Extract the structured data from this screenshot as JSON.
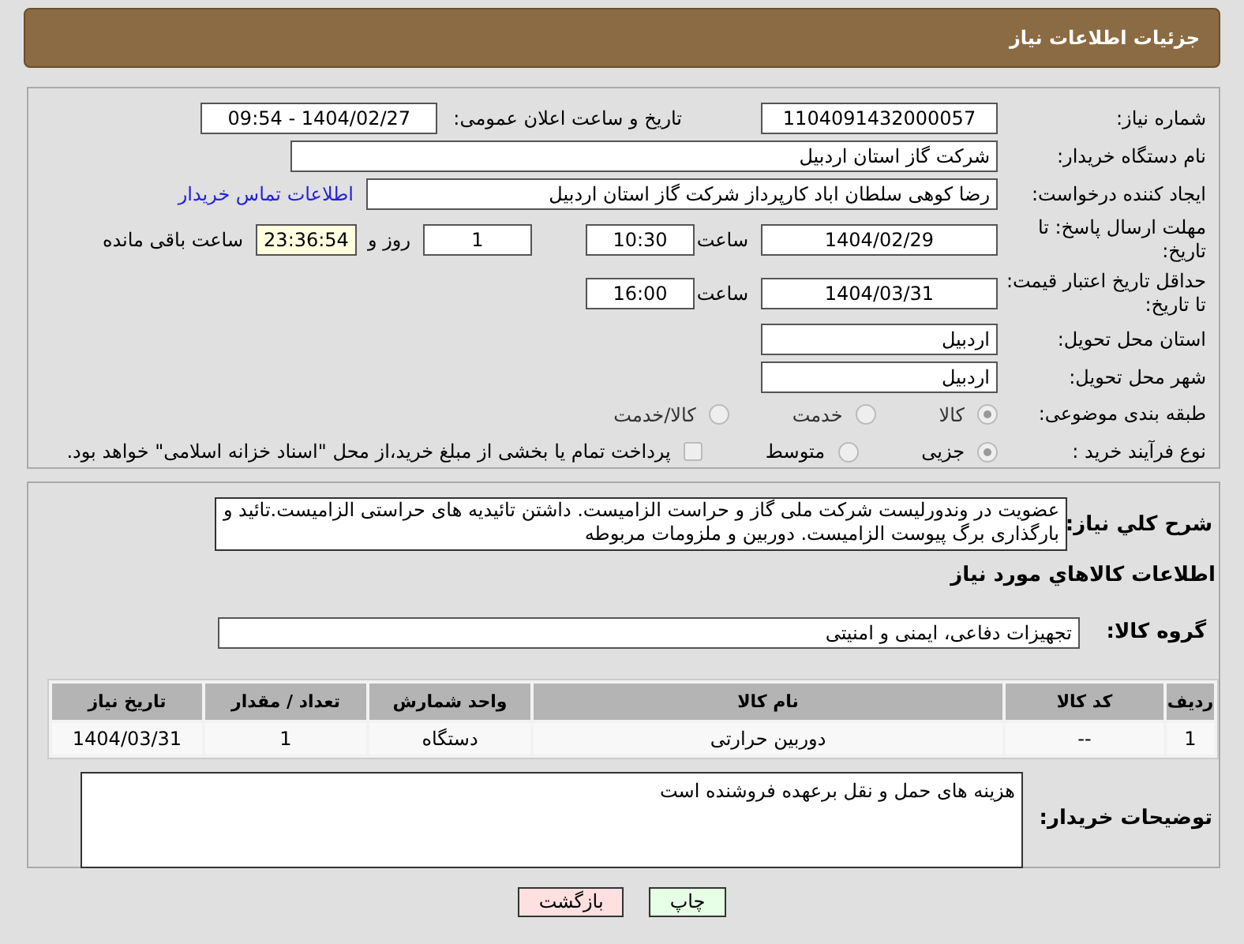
{
  "header": {
    "title": "جزئیات اطلاعات نیاز"
  },
  "need_number": {
    "label": "شماره نیاز:",
    "value": "1104091432000057"
  },
  "announce": {
    "label": "تاریخ و ساعت اعلان عمومی:",
    "value": "1404/02/27 - 09:54"
  },
  "buyer_org": {
    "label": "نام دستگاه خریدار:",
    "value": "شرکت گاز استان اردبیل"
  },
  "requester": {
    "label": "ایجاد کننده درخواست:",
    "value": "رضا کوهی سلطان اباد کارپرداز شرکت گاز استان اردبیل",
    "link": "اطلاعات تماس خریدار"
  },
  "deadline": {
    "label": "مهلت ارسال پاسخ: تا تاریخ:",
    "date": "1404/02/29",
    "time_label": "ساعت",
    "time": "10:30",
    "days": "1",
    "days_label": "روز و",
    "remaining": "23:36:54",
    "remaining_label": "ساعت باقی مانده"
  },
  "validity": {
    "label": "حداقل تاریخ اعتبار قیمت: تا تاریخ:",
    "date": "1404/03/31",
    "time_label": "ساعت",
    "time": "16:00"
  },
  "province": {
    "label": "استان محل تحویل:",
    "value": "اردبیل"
  },
  "city": {
    "label": "شهر محل تحویل:",
    "value": "اردبیل"
  },
  "category": {
    "label": "طبقه بندی موضوعی:",
    "options": [
      {
        "label": "کالا",
        "selected": true
      },
      {
        "label": "خدمت",
        "selected": false
      },
      {
        "label": "کالا/خدمت",
        "selected": false
      }
    ]
  },
  "process": {
    "label": "نوع فرآیند خرید :",
    "options": [
      {
        "label": "جزیی",
        "selected": true
      },
      {
        "label": "متوسط",
        "selected": false
      }
    ],
    "checkbox": {
      "label": "پرداخت تمام یا بخشی از مبلغ خرید،از محل \"اسناد خزانه اسلامی\" خواهد بود.",
      "checked": false
    }
  },
  "description": {
    "label": "شرح کلي نیاز:",
    "value": "عضویت در وندورلیست شرکت ملی گاز و حراست الزامیست. داشتن تائیدیه های حراستی الزامیست.تائید و بارگذاری برگ پیوست الزامیست. دوربین و ملزومات مربوطه"
  },
  "goods_heading": "اطلاعات کالاهاي مورد نياز",
  "goods_group": {
    "label": "گروه کالا:",
    "value": "تجهیزات دفاعی، ایمنی و امنیتی"
  },
  "table": {
    "columns": [
      "ردیف",
      "کد کالا",
      "نام کالا",
      "واحد شمارش",
      "تعداد / مقدار",
      "تاریخ نیاز"
    ],
    "rows": [
      [
        "1",
        "--",
        "دوربین حرارتی",
        "دستگاه",
        "1",
        "1404/03/31"
      ]
    ]
  },
  "buyer_notes": {
    "label": "توضیحات خریدار:",
    "value": "هزینه های حمل و نقل برعهده فروشنده است"
  },
  "buttons": [
    {
      "label": "چاپ",
      "kind": "print"
    },
    {
      "label": "بازگشت",
      "kind": "back"
    }
  ]
}
